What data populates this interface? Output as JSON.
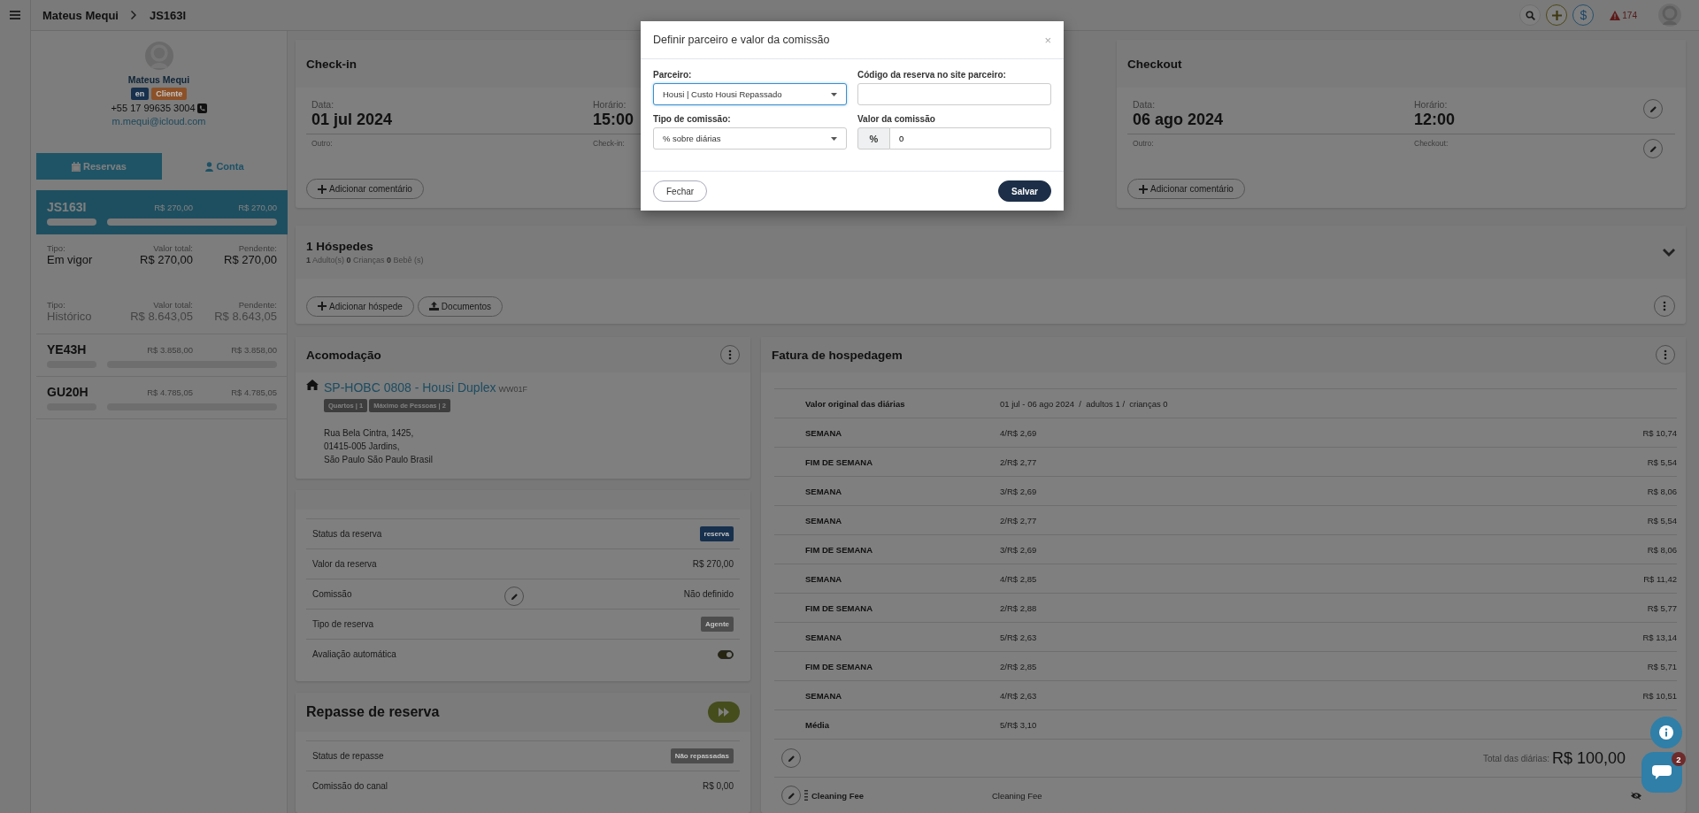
{
  "topbar": {
    "breadcrumb": [
      "Mateus Mequi",
      "JS163I"
    ],
    "currency": "$",
    "alerts": "174"
  },
  "guest": {
    "name": "Mateus Mequi",
    "badges": [
      {
        "label": "en",
        "color": "#17304d"
      },
      {
        "label": "Cliente",
        "color": "#8c5128"
      }
    ],
    "phone": "+55 17 99635 3004",
    "email": "m.mequi@icloud.com"
  },
  "side_tabs": [
    {
      "label": "Reservas",
      "selected": true
    },
    {
      "label": "Conta",
      "selected": false
    }
  ],
  "active_reservations": [
    {
      "code": "JS163I",
      "total": "R$ 270,00",
      "pending": "R$ 270,00",
      "selected": true
    }
  ],
  "summaries": [
    {
      "type_label": "Tipo:",
      "type": "Em vigor",
      "total_label": "Valor total:",
      "total": "R$ 270,00",
      "pending_label": "Pendente:",
      "pending": "R$ 270,00",
      "muted": false
    },
    {
      "type_label": "Tipo:",
      "type": "Histórico",
      "total_label": "Valor total:",
      "total": "R$ 8.643,05",
      "pending_label": "Pendente:",
      "pending": "R$ 8.643,05",
      "muted": true
    }
  ],
  "history": [
    {
      "code": "YE43H",
      "total": "R$ 3.858,00",
      "pending": "R$ 3.858,00",
      "selected": false
    },
    {
      "code": "GU20H",
      "total": "R$ 4.785,05",
      "pending": "R$ 4.785,05",
      "selected": false
    }
  ],
  "stay_cards": [
    {
      "title": "Check-in",
      "date_label": "Data:",
      "date": "01 jul 2024",
      "time_label": "Horário:",
      "time": "15:00",
      "other_label": "Outro:",
      "note_label": "Check-in:",
      "button": "Adicionar comentário"
    },
    {
      "title": "Checkout",
      "date_label": "Data:",
      "date": "06 ago 2024",
      "time_label": "Horário:",
      "time": "12:00",
      "other_label": "Outro:",
      "note_label": "Checkout:",
      "button": "Adicionar comentário",
      "editable": true
    }
  ],
  "guests": {
    "title": "1 Hóspedes",
    "summary": "**1** Adulto(s) **0** Crianças **0** Bebê (s)",
    "expanded": false,
    "buttons": [
      {
        "label": "Adicionar hóspede"
      },
      {
        "label": "Documentos"
      }
    ]
  },
  "accommodation": {
    "title": "Acomodação",
    "name": "SP-HOBC 0808 - Housi Duplex",
    "code": "WW01F",
    "tags": [
      "Quartos | 1",
      "Máximo de Pessoas | 2"
    ],
    "address": [
      "Rua Bela Cintra, 1425,",
      "01415-005 Jardins,",
      "São Paulo São Paulo Brasil"
    ]
  },
  "reservation_details": {
    "rows": [
      {
        "kind": "badge",
        "label": "Status da reserva",
        "value": "reserva",
        "color": "#17304d"
      },
      {
        "kind": "text",
        "label": "Valor da reserva",
        "value": "R$ 270,00"
      },
      {
        "kind": "editable",
        "label": "Comissão",
        "value": "Não definido"
      },
      {
        "kind": "badge",
        "label": "Tipo de reserva",
        "value": "Agente",
        "color": "#4d4d4d"
      },
      {
        "kind": "toggle",
        "label": "Avaliação automática",
        "on": true
      }
    ]
  },
  "transfer": {
    "title": "Repasse de reserva",
    "rows": [
      {
        "kind": "badge",
        "label": "Status de repasse",
        "value": "Não repassadas",
        "color": "#4d4d4d"
      },
      {
        "kind": "text",
        "label": "Comissão do canal",
        "value": "R$ 0,00"
      }
    ]
  },
  "invoice": {
    "title": "Fatura de hospedagem",
    "rows": [
      {
        "label": "Valor original das diárias",
        "detail": "01 jul - 06 ago 2024  /  adultos 1 /  crianças 0"
      },
      {
        "label": "SEMANA",
        "detail": "4/R$ 2,69",
        "amount": "R$ 10,74"
      },
      {
        "label": "FIM DE SEMANA",
        "detail": "2/R$ 2,77",
        "amount": "R$ 5,54"
      },
      {
        "label": "SEMANA",
        "detail": "3/R$ 2,69",
        "amount": "R$ 8,06"
      },
      {
        "label": "SEMANA",
        "detail": "2/R$ 2,77",
        "amount": "R$ 5,54"
      },
      {
        "label": "FIM DE SEMANA",
        "detail": "3/R$ 2,69",
        "amount": "R$ 8,06"
      },
      {
        "label": "SEMANA",
        "detail": "4/R$ 2,85",
        "amount": "R$ 11,42"
      },
      {
        "label": "FIM DE SEMANA",
        "detail": "2/R$ 2,88",
        "amount": "R$ 5,77"
      },
      {
        "label": "SEMANA",
        "detail": "5/R$ 2,63",
        "amount": "R$ 13,14"
      },
      {
        "label": "FIM DE SEMANA",
        "detail": "2/R$ 2,85",
        "amount": "R$ 5,71"
      },
      {
        "label": "SEMANA",
        "detail": "4/R$ 2,63",
        "amount": "R$ 10,51"
      },
      {
        "label": "Média",
        "detail": "5/R$ 3,10"
      }
    ],
    "total_label": "Total das diárias:",
    "total": "R$ 100,00",
    "fees": [
      {
        "label": "Cleaning Fee",
        "description": "Cleaning Fee"
      }
    ]
  },
  "modal": {
    "title": "Definir parceiro e valor da comissão",
    "close": "×",
    "fields": [
      {
        "kind": "select",
        "label": "Parceiro:",
        "value": "Housi | Custo Housi Repassado",
        "focused": true
      },
      {
        "kind": "input",
        "label": "Código da reserva no site parceiro:"
      },
      {
        "kind": "select",
        "label": "Tipo de comissão:",
        "value": "% sobre diárias",
        "focused": false
      },
      {
        "kind": "addon",
        "label": "Valor da comissão",
        "addon": "%",
        "value": "0"
      }
    ],
    "buttons": [
      {
        "label": "Fechar",
        "kind": "secondary"
      },
      {
        "label": "Salvar",
        "kind": "primary"
      }
    ]
  },
  "chat": {
    "count": "2"
  }
}
